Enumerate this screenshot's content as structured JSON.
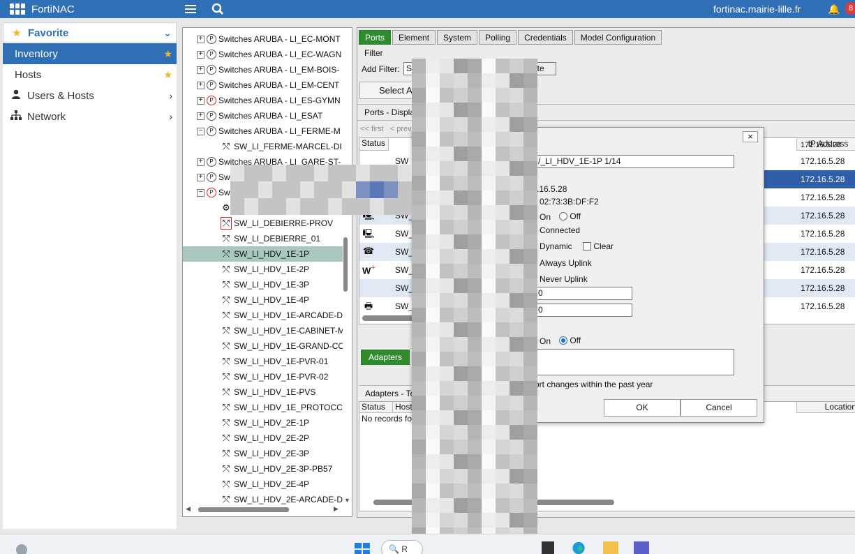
{
  "topbar": {
    "brand": "FortiNAC",
    "hostname": "fortinac.mairie-lille.fr",
    "notification_count": "8"
  },
  "leftnav": {
    "favorite": "Favorite",
    "inventory": "Inventory",
    "hosts": "Hosts",
    "users_hosts": "Users & Hosts",
    "network": "Network"
  },
  "tree": {
    "groups": [
      {
        "label": "Switches ARUBA - LI_EC-MONT",
        "expander": "+",
        "red": false
      },
      {
        "label": "Switches ARUBA - LI_EC-WAGN",
        "expander": "+",
        "red": false
      },
      {
        "label": "Switches ARUBA - LI_EM-BOIS-",
        "expander": "+",
        "red": false
      },
      {
        "label": "Switches ARUBA - LI_EM-CENT",
        "expander": "+",
        "red": false
      },
      {
        "label": "Switches ARUBA - LI_ES-GYMN",
        "expander": "+",
        "red": true
      },
      {
        "label": "Switches ARUBA - LI_ESAT",
        "expander": "+",
        "red": false
      },
      {
        "label": "Switches ARUBA - LI_FERME-M",
        "expander": "−",
        "red": false
      }
    ],
    "ferme_child": "SW_LI_FERME-MARCEL-DI",
    "gare": "Switches ARUBA - LI_GARE-ST-",
    "partial_sw1": "Sw",
    "partial_sw2": "Sw",
    "devices": [
      {
        "label": "SW_LI_DEBIERRE-PROV",
        "redbox": true
      },
      {
        "label": "SW_LI_DEBIERRE_01",
        "redbox": false
      },
      {
        "label": "SW_LI_HDV_1E-1P",
        "redbox": false
      },
      {
        "label": "SW_LI_HDV_1E-2P",
        "redbox": false
      },
      {
        "label": "SW_LI_HDV_1E-3P",
        "redbox": false
      },
      {
        "label": "SW_LI_HDV_1E-4P",
        "redbox": false
      },
      {
        "label": "SW_LI_HDV_1E-ARCADE-D",
        "redbox": false
      },
      {
        "label": "SW_LI_HDV_1E-CABINET-M",
        "redbox": false
      },
      {
        "label": "SW_LI_HDV_1E-GRAND-CC",
        "redbox": false
      },
      {
        "label": "SW_LI_HDV_1E-PVR-01",
        "redbox": false
      },
      {
        "label": "SW_LI_HDV_1E-PVR-02",
        "redbox": false
      },
      {
        "label": "SW_LI_HDV_1E-PVS",
        "redbox": false
      },
      {
        "label": "SW_LI_HDV_1E_PROTOCC",
        "redbox": false
      },
      {
        "label": "SW_LI_HDV_2E-1P",
        "redbox": false
      },
      {
        "label": "SW_LI_HDV_2E-2P",
        "redbox": false
      },
      {
        "label": "SW_LI_HDV_2E-3P",
        "redbox": false
      },
      {
        "label": "SW_LI_HDV_2E-3P-PB57",
        "redbox": false
      },
      {
        "label": "SW_LI_HDV_2E-4P",
        "redbox": false
      },
      {
        "label": "SW_LI_HDV_2E-ARCADE-D",
        "redbox": false
      }
    ],
    "selected_index": 2
  },
  "main": {
    "tabs": [
      "Ports",
      "Element",
      "System",
      "Polling",
      "Credentials",
      "Model Configuration"
    ],
    "filter_label": "Filter",
    "add_filter_label": "Add Filter:",
    "filter_value": "S",
    "frag_ate": "ate",
    "select_btn": "Select A",
    "ports_header": "Ports - Displa",
    "pager_first": "<< first",
    "pager_prev": "< prev",
    "col_status": "Status",
    "col_ip": "IP Address",
    "ip_top_partial": "172.16.5.28",
    "rows": [
      {
        "icon": "",
        "name": "SW_",
        "ip": "172.16.5.28",
        "style": "normal"
      },
      {
        "icon": "",
        "name": "",
        "ip": "172.16.5.28",
        "style": "sel"
      },
      {
        "icon": "",
        "name": "",
        "ip": "172.16.5.28",
        "style": "normal"
      },
      {
        "icon": "🖳",
        "name": "SW_I",
        "ip": "172.16.5.28",
        "style": "alt"
      },
      {
        "icon": "🖳",
        "name": "SW_I",
        "ip": "172.16.5.28",
        "style": "normal"
      },
      {
        "icon": "☎",
        "name": "SW_I",
        "ip": "172.16.5.28",
        "style": "alt"
      },
      {
        "icon": "W+",
        "name": "SW_I",
        "ip": "172.16.5.28",
        "style": "normal"
      },
      {
        "icon": "",
        "name": "SW_I",
        "ip": "172.16.5.28",
        "style": "alt"
      },
      {
        "icon": "🖶",
        "name": "SW_I",
        "ip": "172.16.5.28",
        "style": "normal"
      }
    ],
    "adapters_tab": "Adapters",
    "adapters_header": "Adapters - Te",
    "adapters_col_status": "Status",
    "adapters_col_host": "Host",
    "adapters_col_location": "Location",
    "no_records": "No records fou"
  },
  "dialog": {
    "name_value": "/_LI_HDV_1E-1P 1/14",
    "ip_value": ".16.5.28",
    "mac_value": "02:73:3B:DF:F2",
    "on_label": "On",
    "off_label": "Off",
    "connected_label": "Connected",
    "dynamic_label": "Dynamic",
    "clear_label": "Clear",
    "always_uplink": "Always Uplink",
    "never_uplink": "Never Uplink",
    "field_a": "0",
    "field_b": "0",
    "on2_label": "On",
    "off2_label": "Off",
    "changes_note": "ort changes within the past year",
    "ok": "OK",
    "cancel": "Cancel"
  },
  "taskbar": {
    "search_placeholder": "R"
  }
}
